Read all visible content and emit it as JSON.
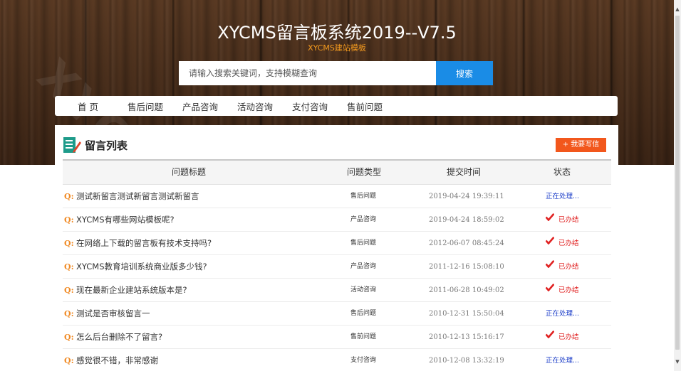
{
  "header": {
    "title": "XYCMS留言板系统2019--V7.5",
    "subtitle": "XYCMS建站模板",
    "watermark": "XYCMS"
  },
  "search": {
    "placeholder": "请输入搜索关键词，支持模糊查询",
    "button_label": "搜索"
  },
  "nav": {
    "items": [
      {
        "label": "首 页"
      },
      {
        "label": "售后问题"
      },
      {
        "label": "产品咨询"
      },
      {
        "label": "活动咨询"
      },
      {
        "label": "支付咨询"
      },
      {
        "label": "售前问题"
      }
    ]
  },
  "panel": {
    "title": "留言列表",
    "write_button": "+ 我要写信"
  },
  "table": {
    "columns": [
      "问题标题",
      "问题类型",
      "提交时间",
      "状态"
    ],
    "q_marker": "Q:",
    "rows": [
      {
        "title": "测试新留言测试新留言测试新留言",
        "type": "售后问题",
        "time": "2019-04-24 19:39:11",
        "status": "正在处理...",
        "status_kind": "processing"
      },
      {
        "title": "XYCMS有哪些网站模板呢?",
        "type": "产品咨询",
        "time": "2019-04-24 18:59:02",
        "status": "已办结",
        "status_kind": "done"
      },
      {
        "title": "在网络上下载的留言板有技术支持吗?",
        "type": "售后问题",
        "time": "2012-06-07 08:45:24",
        "status": "已办结",
        "status_kind": "done"
      },
      {
        "title": "XYCMS教育培训系统商业版多少钱?",
        "type": "产品咨询",
        "time": "2011-12-16 15:08:10",
        "status": "已办结",
        "status_kind": "done"
      },
      {
        "title": "现在最新企业建站系统版本是?",
        "type": "活动咨询",
        "time": "2011-06-28 10:49:02",
        "status": "已办结",
        "status_kind": "done"
      },
      {
        "title": "测试是否审核留言一",
        "type": "售后问题",
        "time": "2010-12-31 15:50:04",
        "status": "正在处理...",
        "status_kind": "processing"
      },
      {
        "title": "怎么后台删除不了留言?",
        "type": "售前问题",
        "time": "2010-12-13 15:16:17",
        "status": "已办结",
        "status_kind": "done"
      },
      {
        "title": "感觉很不错，非常感谢",
        "type": "支付咨询",
        "time": "2010-12-08 13:32:19",
        "status": "正在处理...",
        "status_kind": "processing"
      }
    ]
  },
  "colors": {
    "accent_blue": "#1a8ce6",
    "accent_orange": "#f2571c",
    "subtitle_orange": "#f39a1e",
    "processing_blue": "#1a3cc8",
    "done_red": "#e02222"
  },
  "icons": {
    "panel_icon": "notebook-pen-icon",
    "done_icon": "checkmark-icon"
  }
}
